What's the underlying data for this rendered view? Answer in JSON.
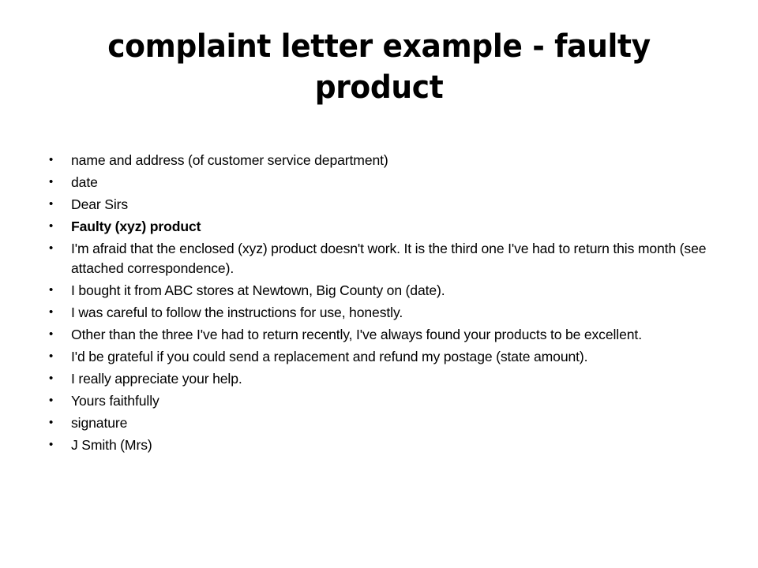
{
  "slide": {
    "background_color": "#ffffff",
    "text_color": "#000000",
    "title": "complaint letter example - faulty product",
    "bullet_glyph": "•",
    "bullets": [
      {
        "text": "name and address (of customer service department)",
        "bold": false
      },
      {
        "text": "date",
        "bold": false
      },
      {
        "text": "Dear Sirs",
        "bold": false
      },
      {
        "text": "Faulty (xyz) product",
        "bold": true
      },
      {
        "text": "I'm afraid that the enclosed (xyz) product doesn't work. It is the third one I've had to return this month (see attached correspondence).",
        "bold": false
      },
      {
        "text": "I bought it from ABC stores at Newtown, Big County on (date).",
        "bold": false
      },
      {
        "text": "I was careful to follow the instructions for use, honestly.",
        "bold": false
      },
      {
        "text": "Other than the three I've had to return recently, I've always found your products to be excellent.",
        "bold": false
      },
      {
        "text": "I'd be grateful if you could send a replacement and refund my postage (state amount).",
        "bold": false
      },
      {
        "text": "I really appreciate your help.",
        "bold": false
      },
      {
        "text": "Yours faithfully",
        "bold": false
      },
      {
        "text": "signature",
        "bold": false
      },
      {
        "text": "J Smith (Mrs)",
        "bold": false
      }
    ]
  }
}
